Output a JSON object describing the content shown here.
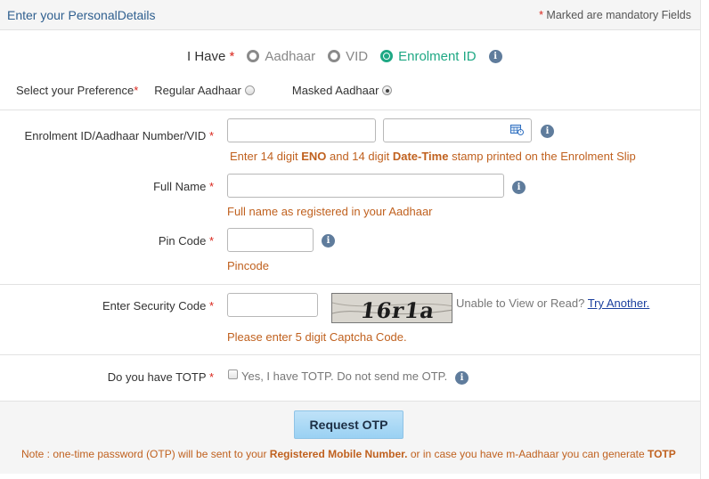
{
  "header": {
    "title": "Enter your PersonalDetails",
    "mandatory_star": "*",
    "mandatory_text": " Marked are mandatory Fields"
  },
  "i_have": {
    "label": "I Have",
    "options": [
      "Aadhaar",
      "VID",
      "Enrolment ID"
    ],
    "selected": "Enrolment ID",
    "selected_color": "#1fa884"
  },
  "preference": {
    "label": "Select your Preference",
    "options": [
      "Regular Aadhaar",
      "Masked Aadhaar"
    ],
    "selected": "Masked Aadhaar"
  },
  "enrolment_field": {
    "label": "Enrolment ID/Aadhaar Number/VID",
    "value_1": "",
    "value_2": "",
    "hint_parts": [
      "Enter 14 digit ",
      "ENO",
      " and 14 digit ",
      "Date-Time",
      " stamp printed on the Enrolment Slip"
    ]
  },
  "full_name_field": {
    "label": "Full Name",
    "value": "",
    "hint": "Full name as registered in your Aadhaar"
  },
  "pin_code_field": {
    "label": "Pin Code",
    "value": "",
    "hint": "Pincode"
  },
  "security_code_field": {
    "label": "Enter Security Code",
    "value": "",
    "captcha_text": "16r1a",
    "unable_text": "Unable to View or Read?",
    "try_another": "Try Another.",
    "hint": "Please enter 5 digit Captcha Code."
  },
  "totp_field": {
    "label": "Do you have TOTP",
    "checkbox_label": "Yes, I have TOTP. Do not send me OTP.",
    "checked": false
  },
  "request_otp_button": "Request OTP",
  "note_parts": [
    "Note : one-time password (OTP) will be sent to your ",
    "Registered Mobile Number.",
    " or in case you have m-Aadhaar you can generate ",
    "TOTP"
  ],
  "required_mark": "*",
  "info_glyph": "i",
  "colors": {
    "hint": "#c0611f",
    "required": "#d9261c",
    "title": "#2f5f8f",
    "button": "#a9d8f5"
  }
}
